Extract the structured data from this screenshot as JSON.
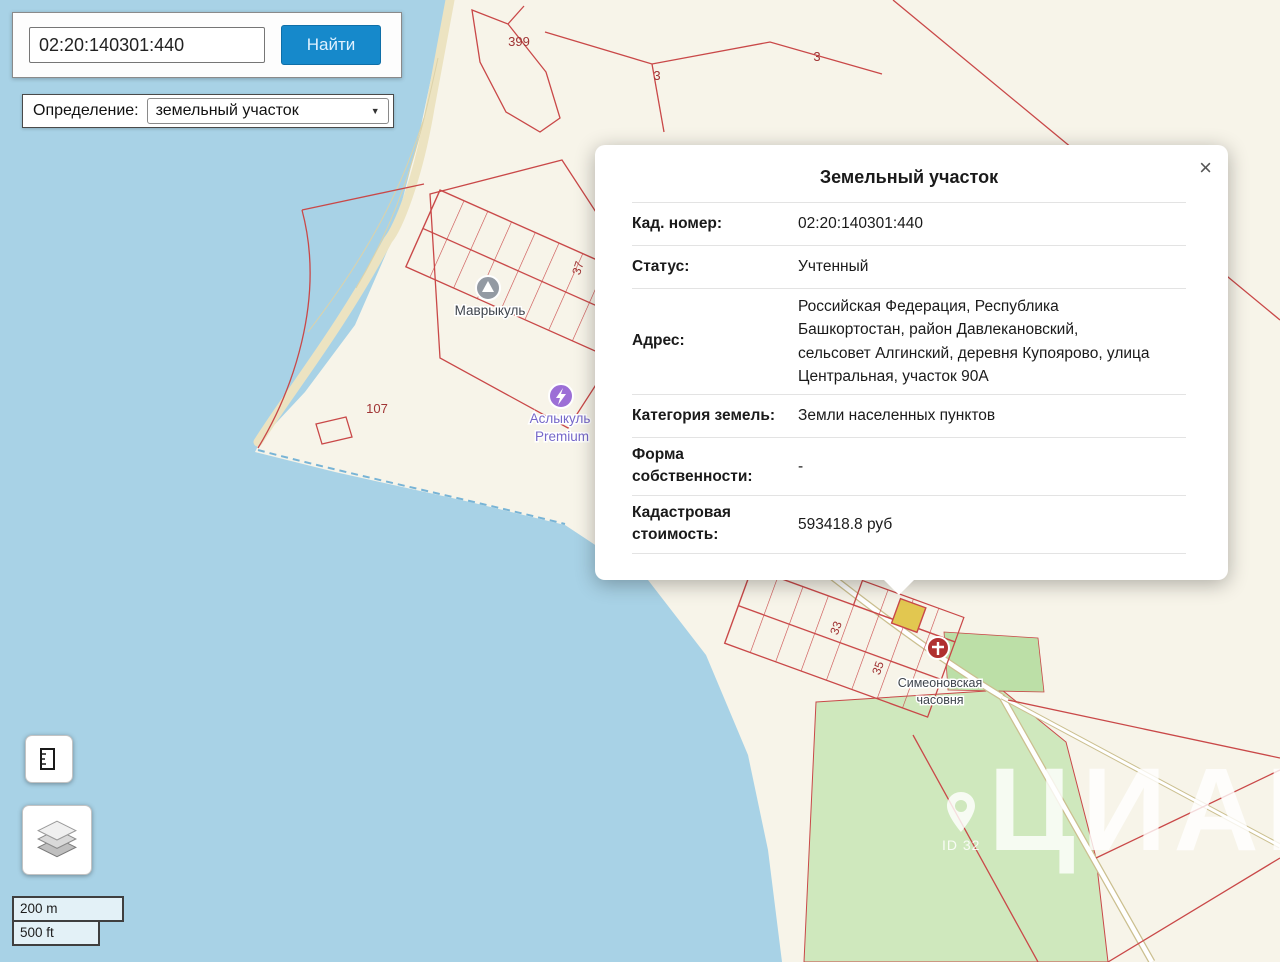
{
  "search": {
    "value": "02:20:140301:440",
    "button_label": "Найти"
  },
  "filter": {
    "label": "Определение:",
    "selected_option": "земельный участок"
  },
  "popup": {
    "title": "Земельный участок",
    "close_symbol": "×",
    "rows": [
      {
        "label": "Кад. номер:",
        "value": "02:20:140301:440"
      },
      {
        "label": "Статус:",
        "value": "Учтенный"
      },
      {
        "label": "Адрес:",
        "value": "Российская Федерация, Республика Башкортостан, район Давлекановский, сельсовет Алгинский, деревня Купоярово, улица Центральная, участок 90А"
      },
      {
        "label": "Категория земель:",
        "value": "Земли населенных пунктов"
      },
      {
        "label": "Форма собственности:",
        "value": "-"
      },
      {
        "label": "Кадастровая стоимость:",
        "value": "593418.8 руб"
      }
    ]
  },
  "map": {
    "parcel_labels": {
      "p399": "399",
      "p3a": "3",
      "p3b": "3",
      "p107": "107",
      "p37": "37",
      "p33": "33",
      "p35": "35"
    },
    "places": {
      "mavrykul": "Маврыкуль",
      "aslykul_line1": "Аслыкуль",
      "aslykul_line2": "Premium",
      "chapel_line1": "Симеоновская",
      "chapel_line2": "часовня"
    },
    "scale": {
      "metric": "200 m",
      "imperial": "500 ft"
    },
    "watermark": {
      "brand": "ЦИАН",
      "id_text": "ID 32"
    }
  },
  "colors": {
    "water": "#a8d2e6",
    "land": "#f7f4e9",
    "parcel_line": "#c94848",
    "parcel_label": "#a03434",
    "highlight_parcel": "#e2c750",
    "accent_blue": "#1689cb",
    "green_area": "#cfe8bd"
  }
}
